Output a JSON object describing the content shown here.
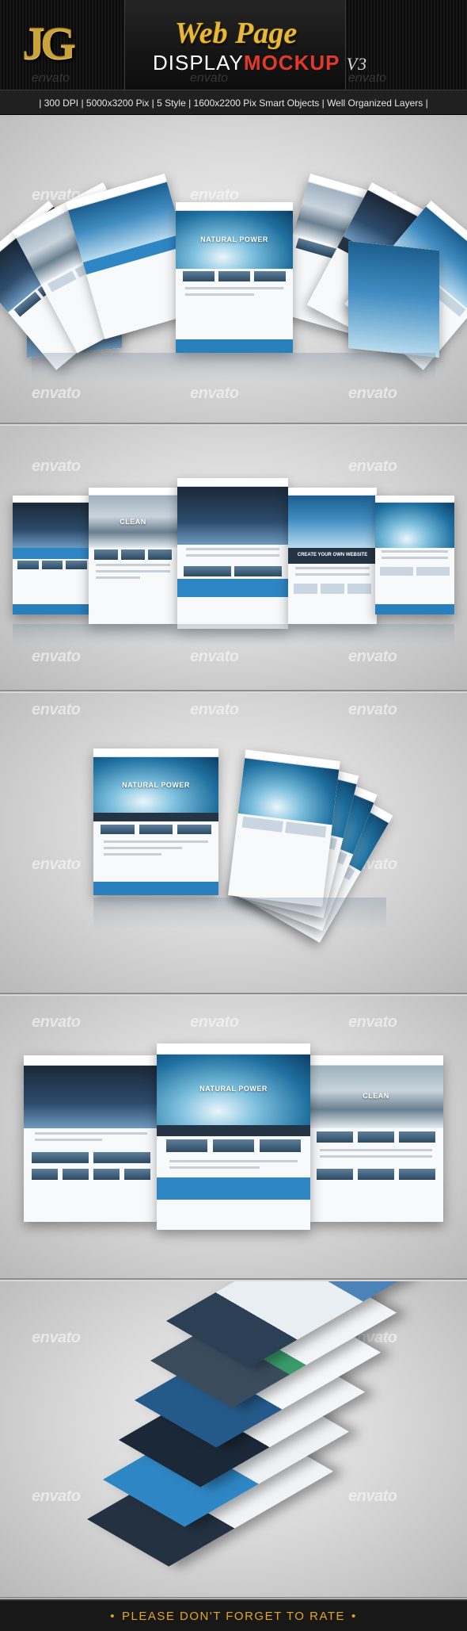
{
  "header": {
    "logo_text": "JG",
    "title_line1": "Web Page",
    "title_display": "DISPLAY",
    "title_mockup": "MOCKUP",
    "title_version": "V3",
    "watermark": "envato"
  },
  "infobar": {
    "text": "| 300 DPI  | 5000x3200 Pix |   5 Style | 1600x2200 Pix Smart Objects | Well Organized Layers |"
  },
  "previews": {
    "hero_title": "NATURAL POWER",
    "clean_label": "CLEAN",
    "create_label": "CREATE YOUR OWN WEBSITE",
    "watermark": "envato"
  },
  "footer": {
    "bullet": "•",
    "text": "PLEASE DON'T FORGET TO RATE"
  },
  "colors": {
    "gold": "#e8b83a",
    "red": "#e23a2a",
    "accent_blue": "#2f86c4",
    "footer_text": "#e2a623"
  }
}
